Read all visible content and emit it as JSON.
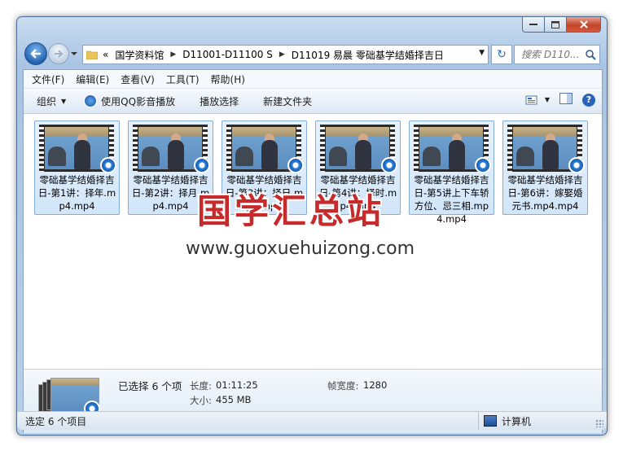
{
  "nav": {
    "breadcrumb_prefix": "«",
    "breadcrumbs": [
      "国学资料馆",
      "D11001-D11100 S",
      "D11019 易晨 零础基学结婚择吉日"
    ],
    "search_placeholder": "搜索 D110..."
  },
  "menu": [
    "文件(F)",
    "编辑(E)",
    "查看(V)",
    "工具(T)",
    "帮助(H)"
  ],
  "toolbar": {
    "organize": "组织",
    "play_qq": "使用QQ影音播放",
    "play_selection": "播放选择",
    "new_folder": "新建文件夹"
  },
  "files": [
    {
      "name": "零础基学结婚择吉日-第1讲：择年.mp4.mp4"
    },
    {
      "name": "零础基学结婚择吉日-第2讲：择月.mp4.mp4"
    },
    {
      "name": "零础基学结婚择吉日-第3讲：择日.mp4.mp4"
    },
    {
      "name": "零础基学结婚择吉日-第4讲：择时.mp4.mp4"
    },
    {
      "name": "零础基学结婚择吉日-第5讲上下车轿方位、忌三相.mp4.mp4"
    },
    {
      "name": "零础基学结婚择吉日-第6讲：嫁娶婚元书.mp4.mp4"
    }
  ],
  "watermark": {
    "main": "国学汇总站",
    "url": "www.guoxuehuizong.com"
  },
  "details": {
    "selected": "已选择 6 个项",
    "length_label": "长度:",
    "length_value": "01:11:25",
    "size_label": "大小:",
    "size_value": "455 MB",
    "framewidth_label": "帧宽度:",
    "framewidth_value": "1280"
  },
  "status": {
    "left": "选定 6 个项目",
    "right": "计算机"
  },
  "colors": {
    "accent": "#2b7fd9",
    "tile_bg": "#d9eafc",
    "tile_border": "#84acdd",
    "watermark": "#c62a2a"
  }
}
